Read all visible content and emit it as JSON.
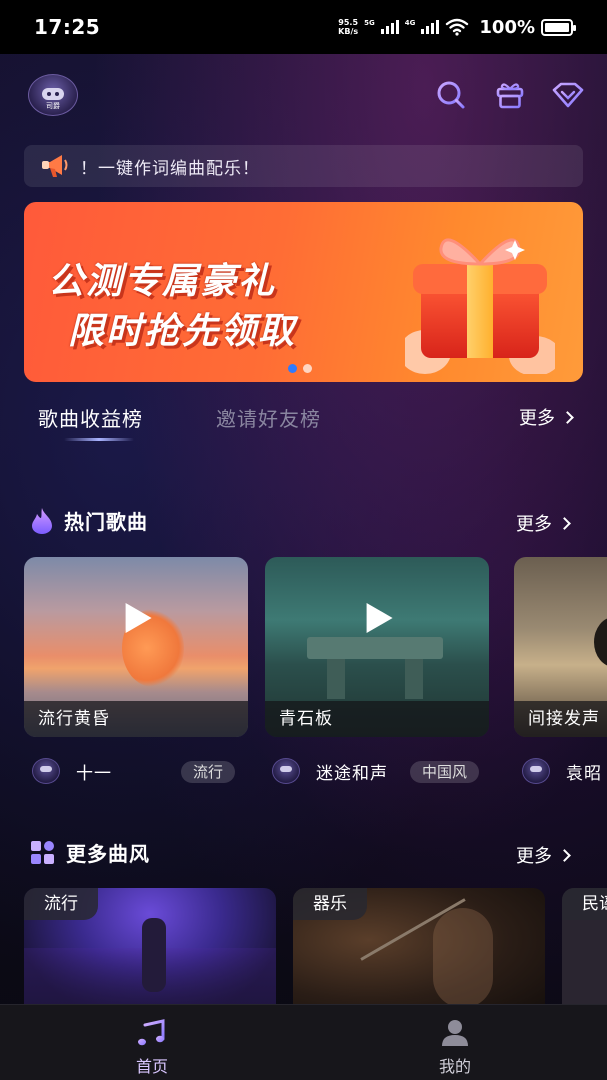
{
  "status_bar": {
    "time": "17:25",
    "net_speed_value": "95.5",
    "net_speed_unit": "KB/s",
    "net_type_1": "5G",
    "net_type_2": "4G",
    "battery": "100%"
  },
  "header": {
    "logo_text": "司爵",
    "icons": [
      "search-icon",
      "gift-icon",
      "diamond-icon"
    ]
  },
  "notice": {
    "text": "！一键作词编曲配乐！"
  },
  "banner": {
    "line1": "公测专属豪礼",
    "line2": "限时抢先领取",
    "dots_active": 0,
    "dots_count": 2,
    "colors": {
      "dot_active": "#2f7bff",
      "dot_inactive": "#ffffff"
    }
  },
  "ranking": {
    "tabs": [
      "歌曲收益榜",
      "邀请好友榜"
    ],
    "active_index": 0,
    "more_label": "更多"
  },
  "hot_songs": {
    "title": "热门歌曲",
    "more_label": "更多",
    "items": [
      {
        "name": "流行黄昏",
        "singer": "十一",
        "tag": "流行"
      },
      {
        "name": "青石板",
        "singer": "迷途和声",
        "tag": "中国风"
      },
      {
        "name": "间接发声",
        "singer": "袁昭",
        "tag": ""
      }
    ]
  },
  "more_styles": {
    "title": "更多曲风",
    "more_label": "更多",
    "items": [
      "流行",
      "器乐",
      "民谣"
    ]
  },
  "bottom_nav": {
    "items": [
      {
        "label": "首页",
        "icon": "music-note-icon",
        "active": true
      },
      {
        "label": "我的",
        "icon": "user-icon",
        "active": false
      }
    ]
  },
  "colors": {
    "accent": "#a78bfa",
    "tab_inactive": "#8a86a0"
  }
}
